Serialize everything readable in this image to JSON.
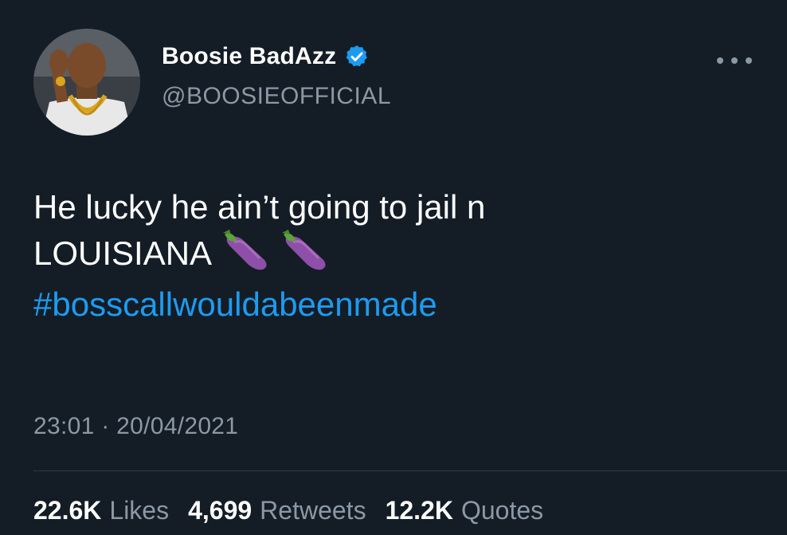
{
  "user": {
    "display_name": "Boosie BadAzz",
    "handle": "@BOOSIEOFFICIAL",
    "verified_icon": "verified-badge-icon"
  },
  "tweet": {
    "line1": "He lucky he ain’t going to jail n",
    "line2": "LOUISIANA",
    "emojis": [
      "eggplant",
      "eggplant"
    ],
    "hashtag": "#bosscallwouldabeenmade",
    "timestamp": "23:01 · 20/04/2021"
  },
  "stats": {
    "likes_value": "22.6K",
    "likes_label": "Likes",
    "retweets_value": "4,699",
    "retweets_label": "Retweets",
    "quotes_value": "12.2K",
    "quotes_label": "Quotes"
  },
  "colors": {
    "background": "#141d26",
    "accent": "#1d9bf0",
    "secondary_text": "#8b98a5"
  }
}
